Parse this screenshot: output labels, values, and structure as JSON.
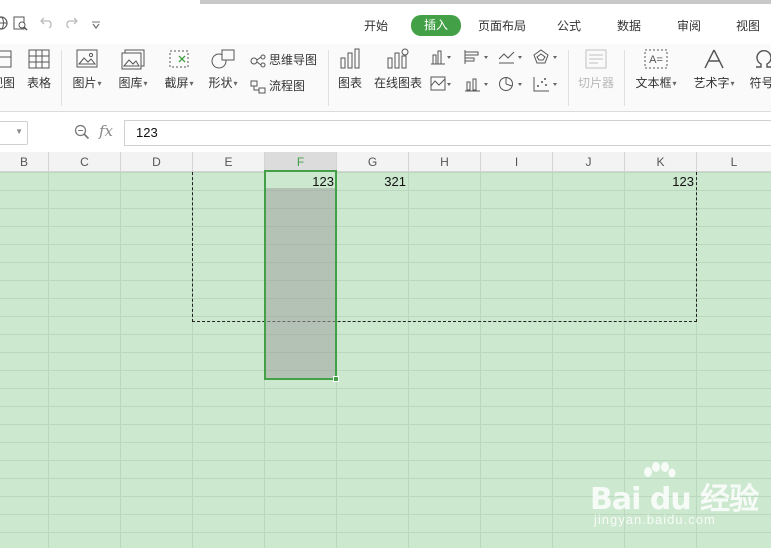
{
  "quick_access": {
    "globe_icon": "globe-icon",
    "preview_icon": "print-preview-icon",
    "undo_icon": "undo-icon",
    "redo_icon": "redo-icon",
    "more_icon": "chevron-down-icon"
  },
  "tabs": [
    {
      "label": "开始",
      "active": false
    },
    {
      "label": "插入",
      "active": true
    },
    {
      "label": "页面布局",
      "active": false
    },
    {
      "label": "公式",
      "active": false
    },
    {
      "label": "数据",
      "active": false
    },
    {
      "label": "审阅",
      "active": false
    },
    {
      "label": "视图",
      "active": false
    }
  ],
  "ribbon": {
    "pivot_chart": "视图",
    "table": "表格",
    "picture": "图片",
    "gallery": "图库",
    "screenshot": "截屏",
    "shapes": "形状",
    "mindmap": "思维导图",
    "flowchart": "流程图",
    "chart": "图表",
    "online_chart": "在线图表",
    "slicer": "切片器",
    "textbox": "文本框",
    "wordart": "艺术字",
    "symbol": "符号"
  },
  "formula_bar": {
    "fx_label": "fx",
    "value": "123"
  },
  "columns": [
    "B",
    "C",
    "D",
    "E",
    "F",
    "G",
    "H",
    "I",
    "J",
    "K",
    "L"
  ],
  "selected_column": "F",
  "cells": {
    "F1": "123",
    "G1": "321",
    "K1": "123"
  },
  "colors": {
    "accent": "#43a047",
    "sheet_background": "#cce8cf",
    "gridline": "#b9d8bd"
  },
  "watermark": {
    "brand": "Bai du 经验",
    "url": "jingyan.baidu.com"
  }
}
